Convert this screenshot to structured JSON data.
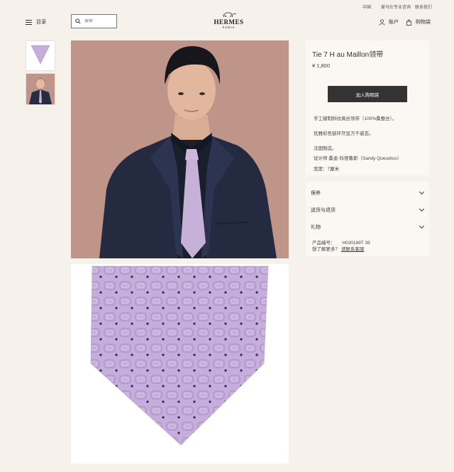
{
  "topbar": {
    "region": "中国",
    "customer_service": "爱马仕专业咨询",
    "contact": "联系我们"
  },
  "header": {
    "menu_label": "目录",
    "search_placeholder": "搜索",
    "logo_main": "HERMES",
    "logo_sub": "PARIS",
    "account_label": "账户",
    "cart_label": "购物袋"
  },
  "product": {
    "title": "Tie 7 H au Maillon领带",
    "price": "¥ 1,800",
    "add_to_bag": "加入购物袋",
    "description_1": "手工缝制斜纹真丝领带（100%桑蚕丝）。",
    "description_2": "优雅彩色链环尽显万千姿态。",
    "made_in": "法国制造。",
    "designer": "设计师 桑迪·科德鲁斯（Sandy Queudrus）",
    "width": "宽度：7厘米",
    "sections": [
      "保养",
      "送货与退货",
      "礼物"
    ],
    "sku_label": "产品编号：",
    "sku_value": "H030189T 39",
    "help_text": "想了解更多？",
    "help_link": "请联系客服"
  },
  "colors": {
    "background": "#f6f1eb",
    "panel": "#fbf8f4",
    "button": "#333333",
    "tie": "#c5aed9",
    "model_bg": "#bf9489"
  }
}
